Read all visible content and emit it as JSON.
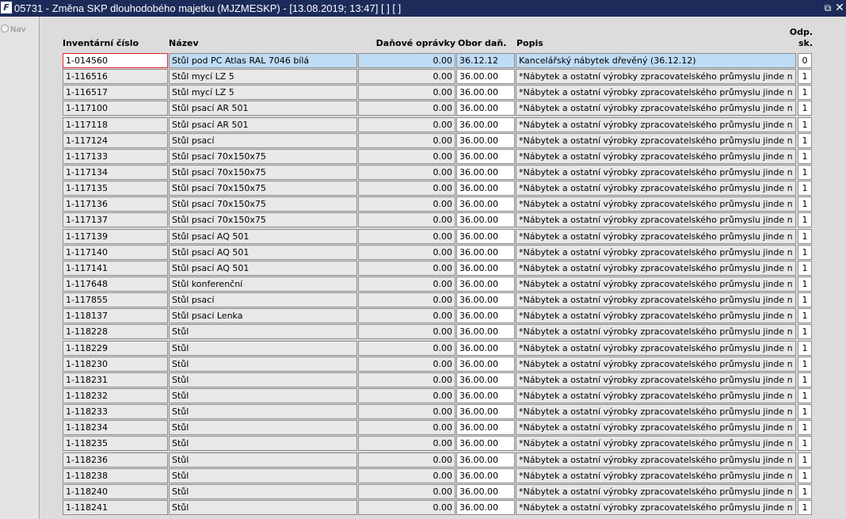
{
  "window": {
    "app_icon": "F",
    "title": "05731 - Změna SKP dlouhodobého majetku (MJZMESKP) - [13.08.2019; 13:47]  [ ]  [ ]",
    "restore_icon": "restore-icon",
    "close_icon": "close-icon"
  },
  "nav": {
    "label": "Nav"
  },
  "columns": {
    "inv": "Inventární číslo",
    "name": "Název",
    "dan": "Daňové oprávky",
    "obor": "Obor daň.",
    "popis": "Popis",
    "odp1": "Odp.",
    "odp2": "sk."
  },
  "rows": [
    {
      "inv": "1-014560",
      "name": "Stůl pod PC Atlas RAL 7046 bílá",
      "dan": "0.00",
      "obor": "36.12.12",
      "popis": "Kancelářský nábytek dřevěný (36.12.12)",
      "odp": "0"
    },
    {
      "inv": "1-116516",
      "name": "Stůl mycí LZ 5",
      "dan": "0.00",
      "obor": "36.00.00",
      "popis": "*Nábytek a ostatní výrobky zpracovatelského průmyslu jinde n",
      "odp": "1"
    },
    {
      "inv": "1-116517",
      "name": "Stůl mycí LZ 5",
      "dan": "0.00",
      "obor": "36.00.00",
      "popis": "*Nábytek a ostatní výrobky zpracovatelského průmyslu jinde n",
      "odp": "1"
    },
    {
      "inv": "1-117100",
      "name": "Stůl psací AR 501",
      "dan": "0.00",
      "obor": "36.00.00",
      "popis": "*Nábytek a ostatní výrobky zpracovatelského průmyslu jinde n",
      "odp": "1"
    },
    {
      "inv": "1-117118",
      "name": "Stůl psací AR 501",
      "dan": "0.00",
      "obor": "36.00.00",
      "popis": "*Nábytek a ostatní výrobky zpracovatelského průmyslu jinde n",
      "odp": "1"
    },
    {
      "inv": "1-117124",
      "name": "Stůl psací",
      "dan": "0.00",
      "obor": "36.00.00",
      "popis": "*Nábytek a ostatní výrobky zpracovatelského průmyslu jinde n",
      "odp": "1"
    },
    {
      "inv": "1-117133",
      "name": "Stůl psací 70x150x75",
      "dan": "0.00",
      "obor": "36.00.00",
      "popis": "*Nábytek a ostatní výrobky zpracovatelského průmyslu jinde n",
      "odp": "1"
    },
    {
      "inv": "1-117134",
      "name": "Stůl psací 70x150x75",
      "dan": "0.00",
      "obor": "36.00.00",
      "popis": "*Nábytek a ostatní výrobky zpracovatelského průmyslu jinde n",
      "odp": "1"
    },
    {
      "inv": "1-117135",
      "name": "Stůl psací 70x150x75",
      "dan": "0.00",
      "obor": "36.00.00",
      "popis": "*Nábytek a ostatní výrobky zpracovatelského průmyslu jinde n",
      "odp": "1"
    },
    {
      "inv": "1-117136",
      "name": "Stůl psací 70x150x75",
      "dan": "0.00",
      "obor": "36.00.00",
      "popis": "*Nábytek a ostatní výrobky zpracovatelského průmyslu jinde n",
      "odp": "1"
    },
    {
      "inv": "1-117137",
      "name": "Stůl psací 70x150x75",
      "dan": "0.00",
      "obor": "36.00.00",
      "popis": "*Nábytek a ostatní výrobky zpracovatelského průmyslu jinde n",
      "odp": "1"
    },
    {
      "inv": "1-117139",
      "name": "Stůl psací AQ 501",
      "dan": "0.00",
      "obor": "36.00.00",
      "popis": "*Nábytek a ostatní výrobky zpracovatelského průmyslu jinde n",
      "odp": "1"
    },
    {
      "inv": "1-117140",
      "name": "Stůl psací AQ 501",
      "dan": "0.00",
      "obor": "36.00.00",
      "popis": "*Nábytek a ostatní výrobky zpracovatelského průmyslu jinde n",
      "odp": "1"
    },
    {
      "inv": "1-117141",
      "name": "Stůl psací AQ 501",
      "dan": "0.00",
      "obor": "36.00.00",
      "popis": "*Nábytek a ostatní výrobky zpracovatelského průmyslu jinde n",
      "odp": "1"
    },
    {
      "inv": "1-117648",
      "name": "Stůl konferenční",
      "dan": "0.00",
      "obor": "36.00.00",
      "popis": "*Nábytek a ostatní výrobky zpracovatelského průmyslu jinde n",
      "odp": "1"
    },
    {
      "inv": "1-117855",
      "name": "Stůl psací",
      "dan": "0.00",
      "obor": "36.00.00",
      "popis": "*Nábytek a ostatní výrobky zpracovatelského průmyslu jinde n",
      "odp": "1"
    },
    {
      "inv": "1-118137",
      "name": "Stůl psací Lenka",
      "dan": "0.00",
      "obor": "36.00.00",
      "popis": "*Nábytek a ostatní výrobky zpracovatelského průmyslu jinde n",
      "odp": "1"
    },
    {
      "inv": "1-118228",
      "name": "Stůl",
      "dan": "0.00",
      "obor": "36.00.00",
      "popis": "*Nábytek a ostatní výrobky zpracovatelského průmyslu jinde n",
      "odp": "1"
    },
    {
      "inv": "1-118229",
      "name": "Stůl",
      "dan": "0.00",
      "obor": "36.00.00",
      "popis": "*Nábytek a ostatní výrobky zpracovatelského průmyslu jinde n",
      "odp": "1"
    },
    {
      "inv": "1-118230",
      "name": "Stůl",
      "dan": "0.00",
      "obor": "36.00.00",
      "popis": "*Nábytek a ostatní výrobky zpracovatelského průmyslu jinde n",
      "odp": "1"
    },
    {
      "inv": "1-118231",
      "name": "Stůl",
      "dan": "0.00",
      "obor": "36.00.00",
      "popis": "*Nábytek a ostatní výrobky zpracovatelského průmyslu jinde n",
      "odp": "1"
    },
    {
      "inv": "1-118232",
      "name": "Stůl",
      "dan": "0.00",
      "obor": "36.00.00",
      "popis": "*Nábytek a ostatní výrobky zpracovatelského průmyslu jinde n",
      "odp": "1"
    },
    {
      "inv": "1-118233",
      "name": "Stůl",
      "dan": "0.00",
      "obor": "36.00.00",
      "popis": "*Nábytek a ostatní výrobky zpracovatelského průmyslu jinde n",
      "odp": "1"
    },
    {
      "inv": "1-118234",
      "name": "Stůl",
      "dan": "0.00",
      "obor": "36.00.00",
      "popis": "*Nábytek a ostatní výrobky zpracovatelského průmyslu jinde n",
      "odp": "1"
    },
    {
      "inv": "1-118235",
      "name": "Stůl",
      "dan": "0.00",
      "obor": "36.00.00",
      "popis": "*Nábytek a ostatní výrobky zpracovatelského průmyslu jinde n",
      "odp": "1"
    },
    {
      "inv": "1-118236",
      "name": "Stůl",
      "dan": "0.00",
      "obor": "36.00.00",
      "popis": "*Nábytek a ostatní výrobky zpracovatelského průmyslu jinde n",
      "odp": "1"
    },
    {
      "inv": "1-118238",
      "name": "Stůl",
      "dan": "0.00",
      "obor": "36.00.00",
      "popis": "*Nábytek a ostatní výrobky zpracovatelského průmyslu jinde n",
      "odp": "1"
    },
    {
      "inv": "1-118240",
      "name": "Stůl",
      "dan": "0.00",
      "obor": "36.00.00",
      "popis": "*Nábytek a ostatní výrobky zpracovatelského průmyslu jinde n",
      "odp": "1"
    },
    {
      "inv": "1-118241",
      "name": "Stůl",
      "dan": "0.00",
      "obor": "36.00.00",
      "popis": "*Nábytek a ostatní výrobky zpracovatelského průmyslu jinde n",
      "odp": "1"
    }
  ]
}
